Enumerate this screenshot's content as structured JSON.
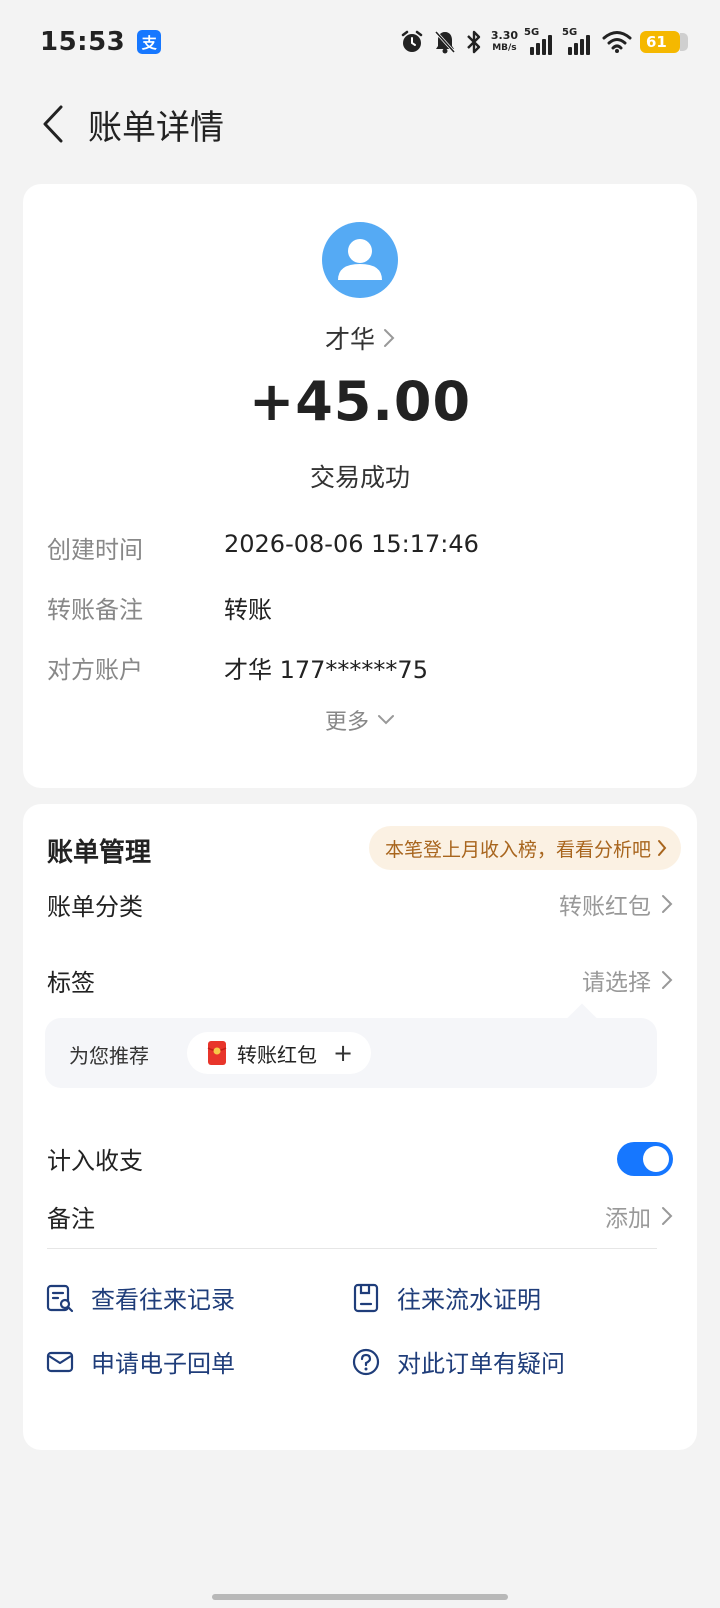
{
  "status_bar": {
    "time": "15:53",
    "app_badge": "支",
    "net_speed_value": "3.30",
    "net_speed_unit": "MB/s",
    "signal_1_label": "5G",
    "signal_2_label": "5G",
    "battery": "61",
    "icons": [
      "alarm-icon",
      "bell-muted-icon",
      "bluetooth-icon",
      "signal-icon",
      "wifi-icon",
      "battery-icon"
    ]
  },
  "header": {
    "title": "账单详情"
  },
  "summary": {
    "payee_name": "才华",
    "amount": "+45.00",
    "status": "交易成功",
    "details": [
      {
        "label": "创建时间",
        "value": "2026-08-06 15:17:46"
      },
      {
        "label": "转账备注",
        "value": "转账"
      },
      {
        "label": "对方账户",
        "value": "才华 177******75"
      }
    ],
    "more_label": "更多"
  },
  "management": {
    "title": "账单管理",
    "promo": "本笔登上月收入榜，看看分析吧",
    "category_label": "账单分类",
    "category_value": "转账红包",
    "tag_label": "标签",
    "tag_value": "请选择",
    "recommend_label": "为您推荐",
    "recommend_chip": "转账红包",
    "recommend_add": "+",
    "count_label": "计入收支",
    "count_enabled": true,
    "note_label": "备注",
    "note_value": "添加"
  },
  "actions": [
    {
      "label": "查看往来记录",
      "icon": "record-search-icon"
    },
    {
      "label": "往来流水证明",
      "icon": "statement-icon"
    },
    {
      "label": "申请电子回单",
      "icon": "mail-icon"
    },
    {
      "label": "对此订单有疑问",
      "icon": "question-icon"
    }
  ],
  "colors": {
    "accent": "#1677ff",
    "link": "#1f3d7a",
    "promo_bg": "#fbf1e3",
    "promo_text": "#a8651d",
    "avatar": "#55aaf4",
    "battery": "#f5b800"
  }
}
